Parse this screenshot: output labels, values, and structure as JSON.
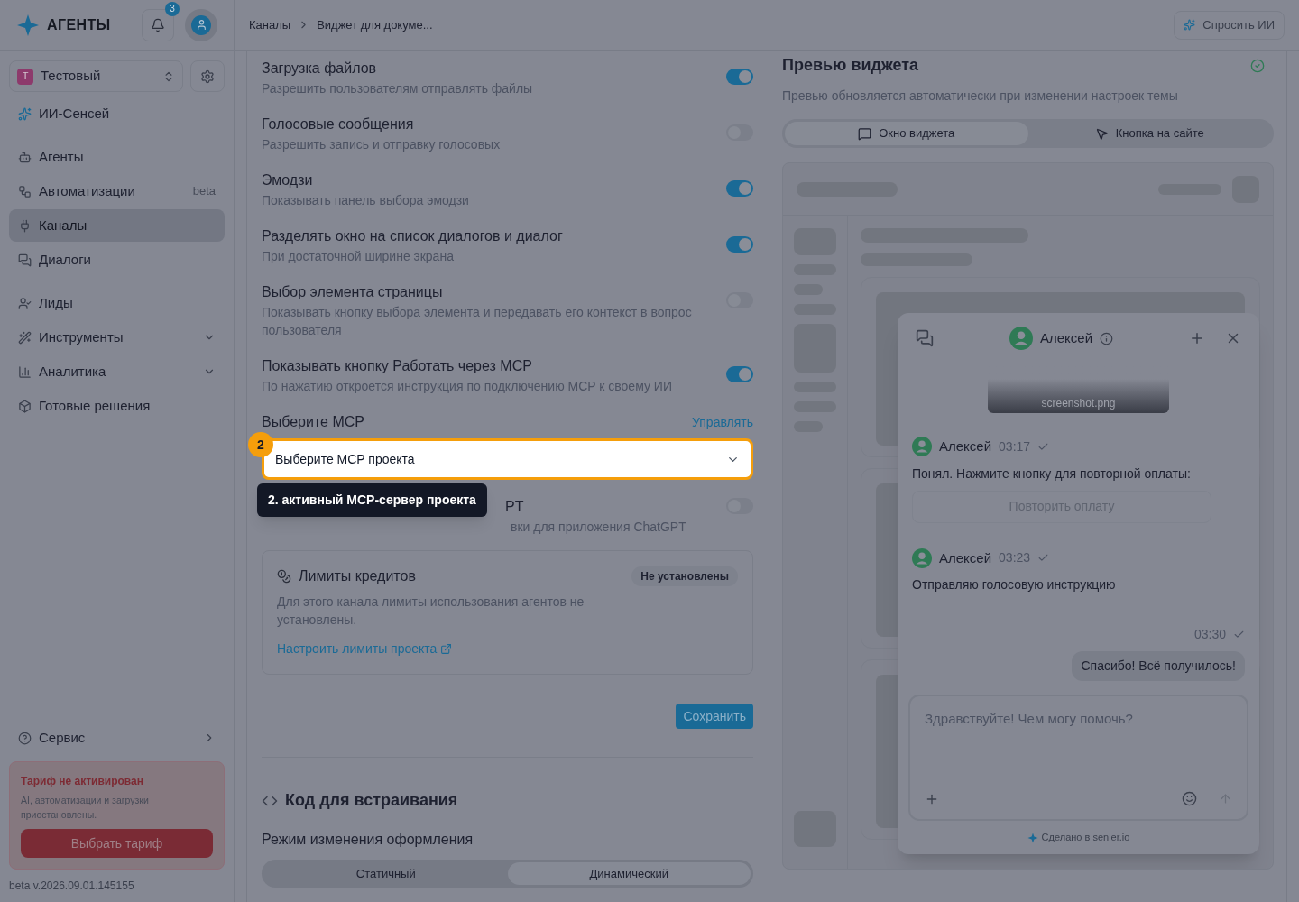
{
  "sidebar": {
    "logo": "АГЕНТЫ",
    "notifications": "3",
    "workspace": {
      "initial": "Т",
      "name": "Тестовый"
    },
    "ai_item": "ИИ-Сенсей",
    "items": [
      {
        "label": "Агенты",
        "selected": false
      },
      {
        "label": "Автоматизации",
        "selected": false,
        "badge": "beta"
      },
      {
        "label": "Каналы",
        "selected": true
      },
      {
        "label": "Диалоги",
        "selected": false
      },
      {
        "label": "Лиды",
        "selected": false
      },
      {
        "label": "Инструменты",
        "selected": false,
        "expandable": true
      },
      {
        "label": "Аналитика",
        "selected": false,
        "expandable": true
      },
      {
        "label": "Готовые решения",
        "selected": false
      }
    ],
    "service": "Сервис",
    "tariff": {
      "title": "Тариф не активирован",
      "text": "AI, автоматизации и загрузки приостановлены.",
      "button": "Выбрать тариф"
    },
    "version": "beta v.2026.09.01.145155"
  },
  "header": {
    "breadcrumbs": [
      "Каналы",
      "Виджет для докуме..."
    ],
    "ask_ai": "Спросить ИИ"
  },
  "settings": {
    "toggles": [
      {
        "title": "Загрузка файлов",
        "description": "Разрешить пользователям отправлять файлы",
        "on": true
      },
      {
        "title": "Голосовые сообщения",
        "description": "Разрешить запись и отправку голосовых",
        "on": false
      },
      {
        "title": "Эмодзи",
        "description": "Показывать панель выбора эмодзи",
        "on": true
      },
      {
        "title": "Разделять окно на список диалогов и диалог",
        "description": "При достаточной ширине экрана",
        "on": true
      },
      {
        "title": "Выбор элемента страницы",
        "description": "Показывать кнопку выбора элемента и передавать его контекст в вопрос пользователя",
        "on": false
      },
      {
        "title": "Показывать кнопку Работать через MCP",
        "description": "По нажатию откроется инструкция по подключению MCP к своему ИИ",
        "on": true
      }
    ],
    "mcp": {
      "label": "Выберите MCP",
      "manage": "Управлять",
      "value": "Выберите MCP проекта"
    },
    "tour": {
      "step": "2",
      "text": "2. активный MCP-сервер проекта"
    },
    "covered_toggle": {
      "title": "PT",
      "description": "вки для приложения ChatGPT",
      "on": false
    },
    "limits": {
      "title": "Лимиты кредитов",
      "badge": "Не установлены",
      "text": "Для этого канала лимиты использования агентов не установлены.",
      "link": "Настроить лимиты проекта"
    },
    "save": "Сохранить",
    "embed_title": "Код для встраивания",
    "mode_label": "Режим изменения оформления",
    "modes": [
      {
        "label": "Статичный",
        "selected": false
      },
      {
        "label": "Динамический",
        "selected": true
      }
    ]
  },
  "preview": {
    "title": "Превью виджета",
    "subtitle": "Превью обновляется автоматически при изменении настроек темы",
    "tabs": [
      {
        "label": "Окно виджета",
        "selected": true
      },
      {
        "label": "Кнопка на сайте",
        "selected": false
      }
    ],
    "widget": {
      "agent": "Алексей",
      "attachment": "screenshot.png",
      "messages": [
        {
          "kind": "agent",
          "name": "Алексей",
          "time": "03:17",
          "text": "Понял. Нажмите кнопку для повторной оплаты:",
          "button": "Повторить оплату"
        },
        {
          "kind": "agent",
          "name": "Алексей",
          "time": "03:23",
          "text": "Отправляю голосовую инструкцию"
        },
        {
          "kind": "user",
          "time": "03:30",
          "text": "Спасибо! Всё получилось!"
        }
      ],
      "placeholder": "Здравствуйте! Чем могу помочь?",
      "footer": "Сделано в senler.io"
    }
  }
}
